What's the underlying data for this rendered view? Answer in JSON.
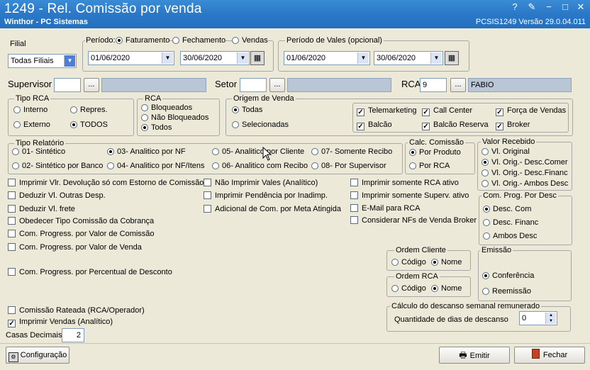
{
  "window": {
    "title": "1249 - Rel. Comissão por venda",
    "subtitle": "Winthor - PC Sistemas",
    "version": "PCSIS1249  Versão  29.0.04.011"
  },
  "filial": {
    "label": "Filial",
    "value": "Todas Filiais"
  },
  "periodo": {
    "label": "Período:",
    "opt1": "Faturamento",
    "opt2": "Fechamento",
    "opt3": "Vendas",
    "start": "01/06/2020",
    "end": "30/06/2020"
  },
  "vales": {
    "label": "Período de Vales (opcional)",
    "start": "01/06/2020",
    "end": "30/06/2020"
  },
  "supervisor": {
    "label": "Supervisor",
    "btn": "..."
  },
  "setor": {
    "label": "Setor",
    "btn": "..."
  },
  "rca": {
    "label": "RCA",
    "code": "9",
    "btn": "...",
    "name": "FABIO"
  },
  "tipo_rca": {
    "label": "Tipo RCA",
    "interno": "Interno",
    "repres": "Repres.",
    "externo": "Externo",
    "todos": "TODOS"
  },
  "rca_status": {
    "label": "RCA",
    "bloqueados": "Bloqueados",
    "nao_bloqueados": "Não Bloqueados",
    "todos": "Todos"
  },
  "origem": {
    "label": "Origem de Venda",
    "todas": "Todas",
    "selecionadas": "Selecionadas",
    "telemarketing": "Telemarketing",
    "call_center": "Call Center",
    "forca_vendas": "Força de Vendas",
    "balcao": "Balcão",
    "balcao_reserva": "Balcão Reserva",
    "broker": "Broker"
  },
  "tipo_relatorio": {
    "label": "Tipo Relatório",
    "o1": "01- Sintético",
    "o2": "02- Sintético por Banco",
    "o3": "03- Analitico por NF",
    "o4": "04- Analitico por NF/Itens",
    "o5": "05- Analitico por Cliente",
    "o6": "06- Analitico com Recibo",
    "o7": "07- Somente Recibo",
    "o8": "08- Por Supervisor"
  },
  "calc_comissao": {
    "label": "Calc. Comissão",
    "produto": "Por Produto",
    "rca": "Por RCA"
  },
  "valor_recebido": {
    "label": "Valor Recebido",
    "o1": "Vl. Original",
    "o2": "Vl. Orig.- Desc.Comer",
    "o3": "Vl. Orig.- Desc.Financ",
    "o4": "Vl. Orig.- Ambos Desc"
  },
  "checks": {
    "c1": "Imprimir Vlr. Devolução só com Estorno de Comissão",
    "c2": "Deduzir Vl. Outras Desp.",
    "c3": "Deduzir Vl. frete",
    "c4": "Obedecer Tipo Comissão da Cobrança",
    "c5": "Com. Progress. por Valor de Comissão",
    "c6": "Com. Progress. por Valor de Venda",
    "c7": "Com. Progress. por Percentual de Desconto",
    "c8": "Comissão Rateada (RCA/Operador)",
    "c9": "Imprimir Vendas (Analítico)",
    "m1": "Não Imprimir Vales (Analítico)",
    "m2": "Imprimir Pendência por Inadimp.",
    "m3": "Adicional de Com. por Meta Atingida",
    "r1": "Imprimir somente RCA ativo",
    "r2": "Imprimir somente Superv. ativo",
    "r3": "E-Mail para RCA",
    "r4": "Considerar NFs de Venda Broker"
  },
  "casas": {
    "label": "Casas Decimais",
    "value": "2"
  },
  "com_prog": {
    "label": "Com. Prog. Por Desc",
    "o1": "Desc. Com",
    "o2": "Desc. Financ",
    "o3": "Ambos Desc"
  },
  "ordem_cliente": {
    "label": "Ordem Cliente",
    "codigo": "Código",
    "nome": "Nome"
  },
  "ordem_rca": {
    "label": "Ordem RCA",
    "codigo": "Código",
    "nome": "Nome"
  },
  "emissao": {
    "label": "Emissão",
    "conferencia": "Conferência",
    "reemissao": "Reemissão"
  },
  "descanso": {
    "label": "Cálculo do descanso semanal remunerado",
    "qtd_label": "Quantidade de dias de descanso",
    "qtd": "0"
  },
  "buttons": {
    "config": "Configuração",
    "emitir": "Emitir",
    "fechar": "Fechar"
  }
}
